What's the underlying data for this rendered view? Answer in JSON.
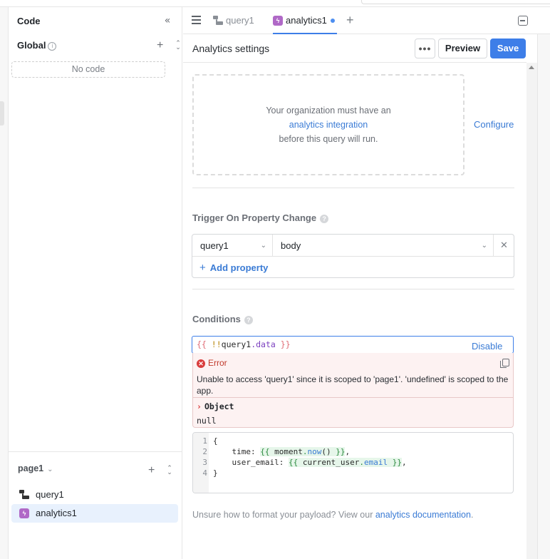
{
  "code_panel": {
    "title": "Code",
    "global_label": "Global",
    "no_code_text": "No code",
    "page_label": "page1",
    "tree": [
      {
        "label": "query1",
        "icon": "query-icon"
      },
      {
        "label": "analytics1",
        "icon": "analytics-icon",
        "selected": true
      }
    ]
  },
  "tabs": [
    {
      "label": "query1",
      "icon": "query-icon",
      "active": false
    },
    {
      "label": "analytics1",
      "icon": "analytics-icon",
      "active": true,
      "unsaved": true
    }
  ],
  "settings": {
    "title": "Analytics settings",
    "more_label": "•••",
    "preview_label": "Preview",
    "save_label": "Save"
  },
  "integration": {
    "line1": "Your organization must have an",
    "link": "analytics integration",
    "line3": "before this query will run.",
    "configure_label": "Configure"
  },
  "trigger": {
    "label": "Trigger On Property Change",
    "query_value": "query1",
    "property_value": "body",
    "add_property_label": "Add property"
  },
  "conditions": {
    "label": "Conditions",
    "open_brace": "{{",
    "bang": "!!",
    "ident": "query1",
    "prop": ".data",
    "close_brace": "}}",
    "disable_label": "Disable",
    "error": {
      "title": "Error",
      "message": "Unable to access 'query1' since it is scoped to 'page1'. 'undefined' is scoped to the app.",
      "object_label": "Object",
      "value": "null"
    }
  },
  "payload_editor": {
    "line_numbers": [
      "1",
      "2",
      "3",
      "4"
    ],
    "line1": "{",
    "line2_key": "    time: ",
    "line2_open": "{{ ",
    "line2_obj": "moment",
    "line2_dot": ".",
    "line2_fn": "now",
    "line2_rest": "() ",
    "line2_close": "}}",
    "line2_comma": ",",
    "line3_key": "    user_email: ",
    "line3_open": "{{ ",
    "line3_obj": "current_user",
    "line3_dot": ".",
    "line3_prop": "email",
    "line3_close": " }}",
    "line3_comma": ",",
    "line4": "}"
  },
  "footer": {
    "text": "Unsure how to format your payload? View our ",
    "link": "analytics documentation",
    "end": "."
  },
  "colors": {
    "accent": "#3d7ee8",
    "link": "#3a7bd5",
    "error": "#d93c3c",
    "analytics_icon": "#b069c7"
  }
}
